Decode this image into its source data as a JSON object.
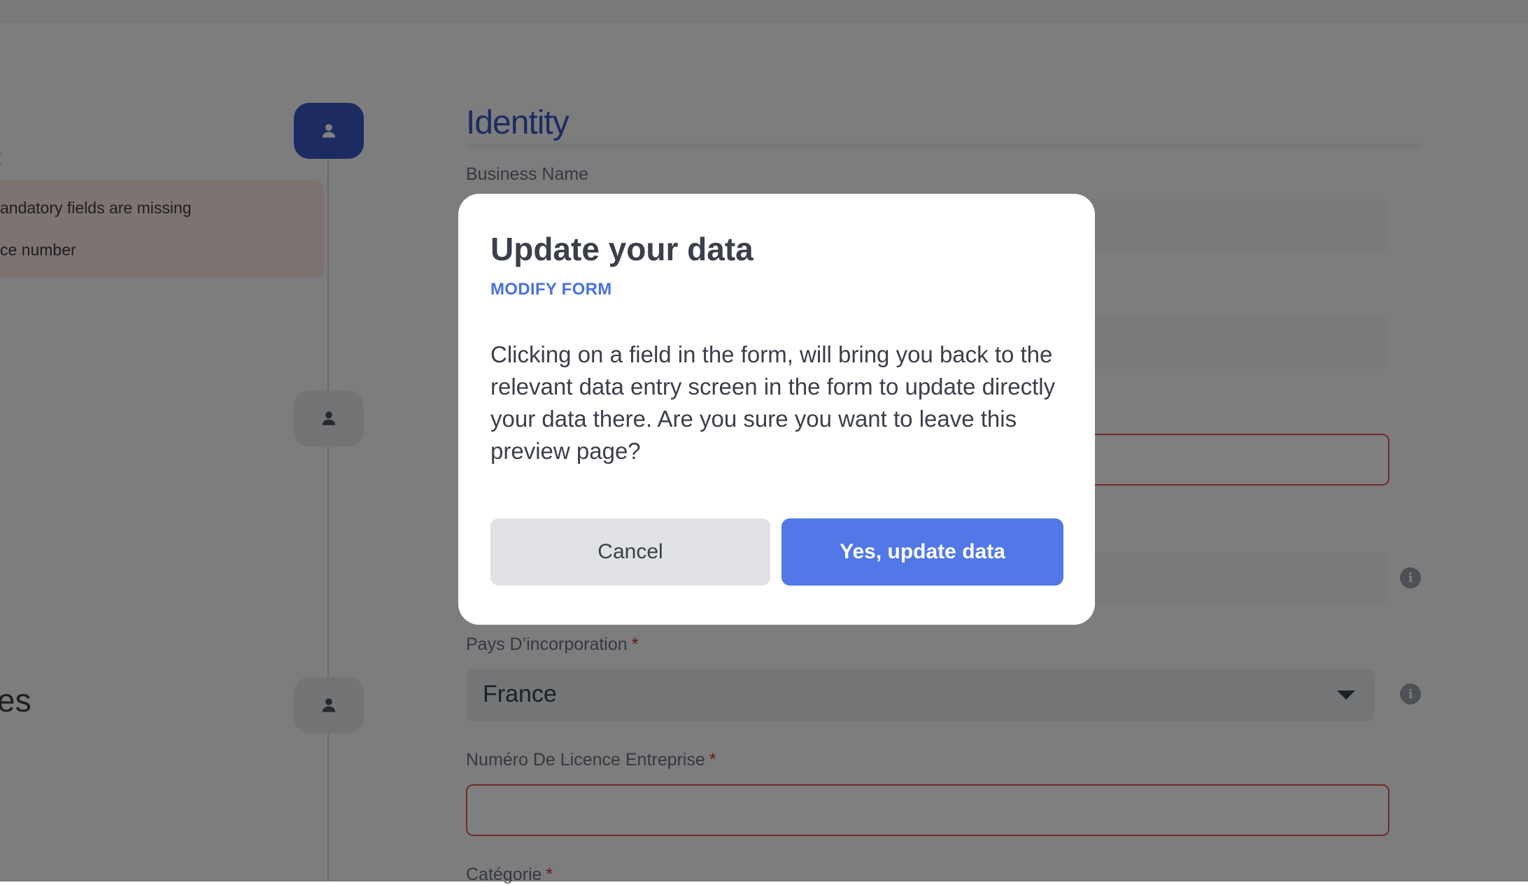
{
  "sidebar": {
    "heading_fragment": ":",
    "warnings": [
      "andatory fields are missing",
      "ce number"
    ],
    "section_fragment": "es"
  },
  "form": {
    "section_title": "Identity",
    "fields": {
      "business_name": {
        "label": "Business Name"
      },
      "pays": {
        "label": "Pays D’incorporation",
        "required": "*",
        "value": "France"
      },
      "licence": {
        "label": "Numéro De Licence Entreprise",
        "required": "*"
      },
      "categorie": {
        "label": "Catégorie",
        "required": "*"
      }
    },
    "info_icon_glyph": "i"
  },
  "modal": {
    "title": "Update your data",
    "subtitle": "MODIFY FORM",
    "body": "Clicking on a field in the form, will bring you back to the relevant data entry screen in the form to update directly your data there. Are you sure you want to leave this preview page?",
    "cancel_label": "Cancel",
    "confirm_label": "Yes, update data"
  },
  "colors": {
    "accent": "#3a57c7",
    "primary_button": "#5178e6",
    "error_border": "#e25555",
    "warning_bg": "#fbe7e3"
  }
}
